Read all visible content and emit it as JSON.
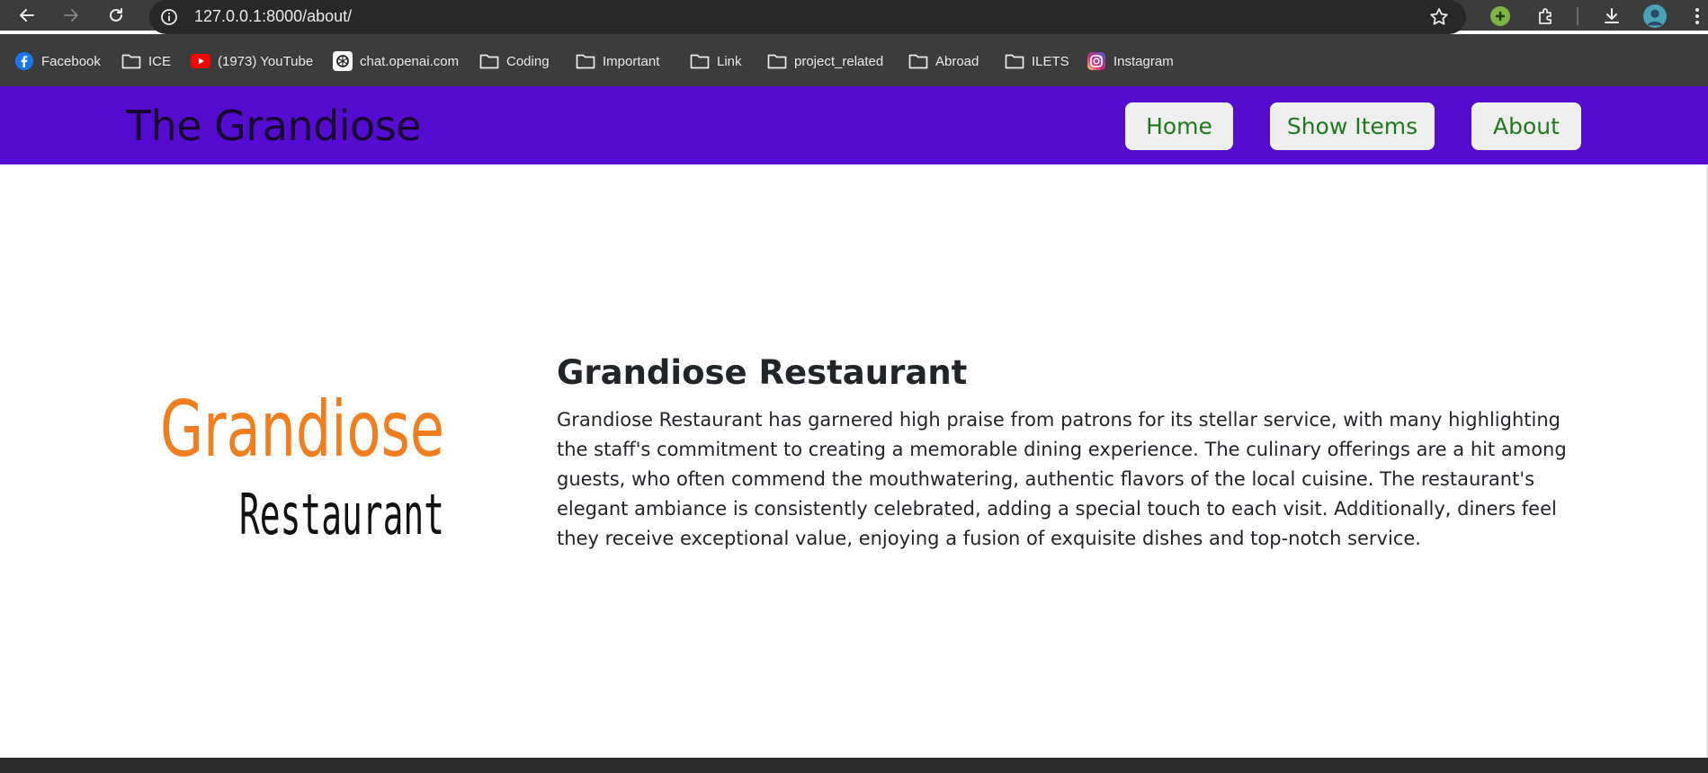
{
  "browser": {
    "url": "127.0.0.1:8000/about/",
    "bookmarks": [
      {
        "label": "Facebook",
        "icon": "facebook-icon"
      },
      {
        "label": "ICE",
        "icon": "folder-icon"
      },
      {
        "label": "(1973) YouTube",
        "icon": "youtube-icon"
      },
      {
        "label": "chat.openai.com",
        "icon": "openai-icon"
      },
      {
        "label": "Coding",
        "icon": "folder-icon"
      },
      {
        "label": "Important",
        "icon": "folder-icon"
      },
      {
        "label": "Link",
        "icon": "folder-icon"
      },
      {
        "label": "project_related",
        "icon": "folder-icon"
      },
      {
        "label": "Abroad",
        "icon": "folder-icon"
      },
      {
        "label": "ILETS",
        "icon": "folder-icon"
      },
      {
        "label": "Instagram",
        "icon": "instagram-icon"
      }
    ]
  },
  "header": {
    "brand": "The Grandiose",
    "nav": [
      {
        "label": "Home"
      },
      {
        "label": "Show Items"
      },
      {
        "label": "About"
      }
    ]
  },
  "main": {
    "logo": {
      "word1": "Grandiose",
      "word2": "Restaurant",
      "color1": "#f07d1e",
      "color2": "#111111"
    },
    "title": "Grandiose Restaurant",
    "description": "Grandiose Restaurant has garnered high praise from patrons for its stellar service, with many highlighting the staff's commitment to creating a memorable dining experience. The culinary offerings are a hit among guests, who often commend the mouthwatering, authentic flavors of the local cuisine. The restaurant's elegant ambiance is consistently celebrated, adding a special touch to each visit. Additionally, diners feel they receive exceptional value, enjoying a fusion of exquisite dishes and top-notch service."
  },
  "colors": {
    "header_bg": "#560bd0",
    "nav_text": "#1f7a1f",
    "nav_bg": "#efefef"
  }
}
